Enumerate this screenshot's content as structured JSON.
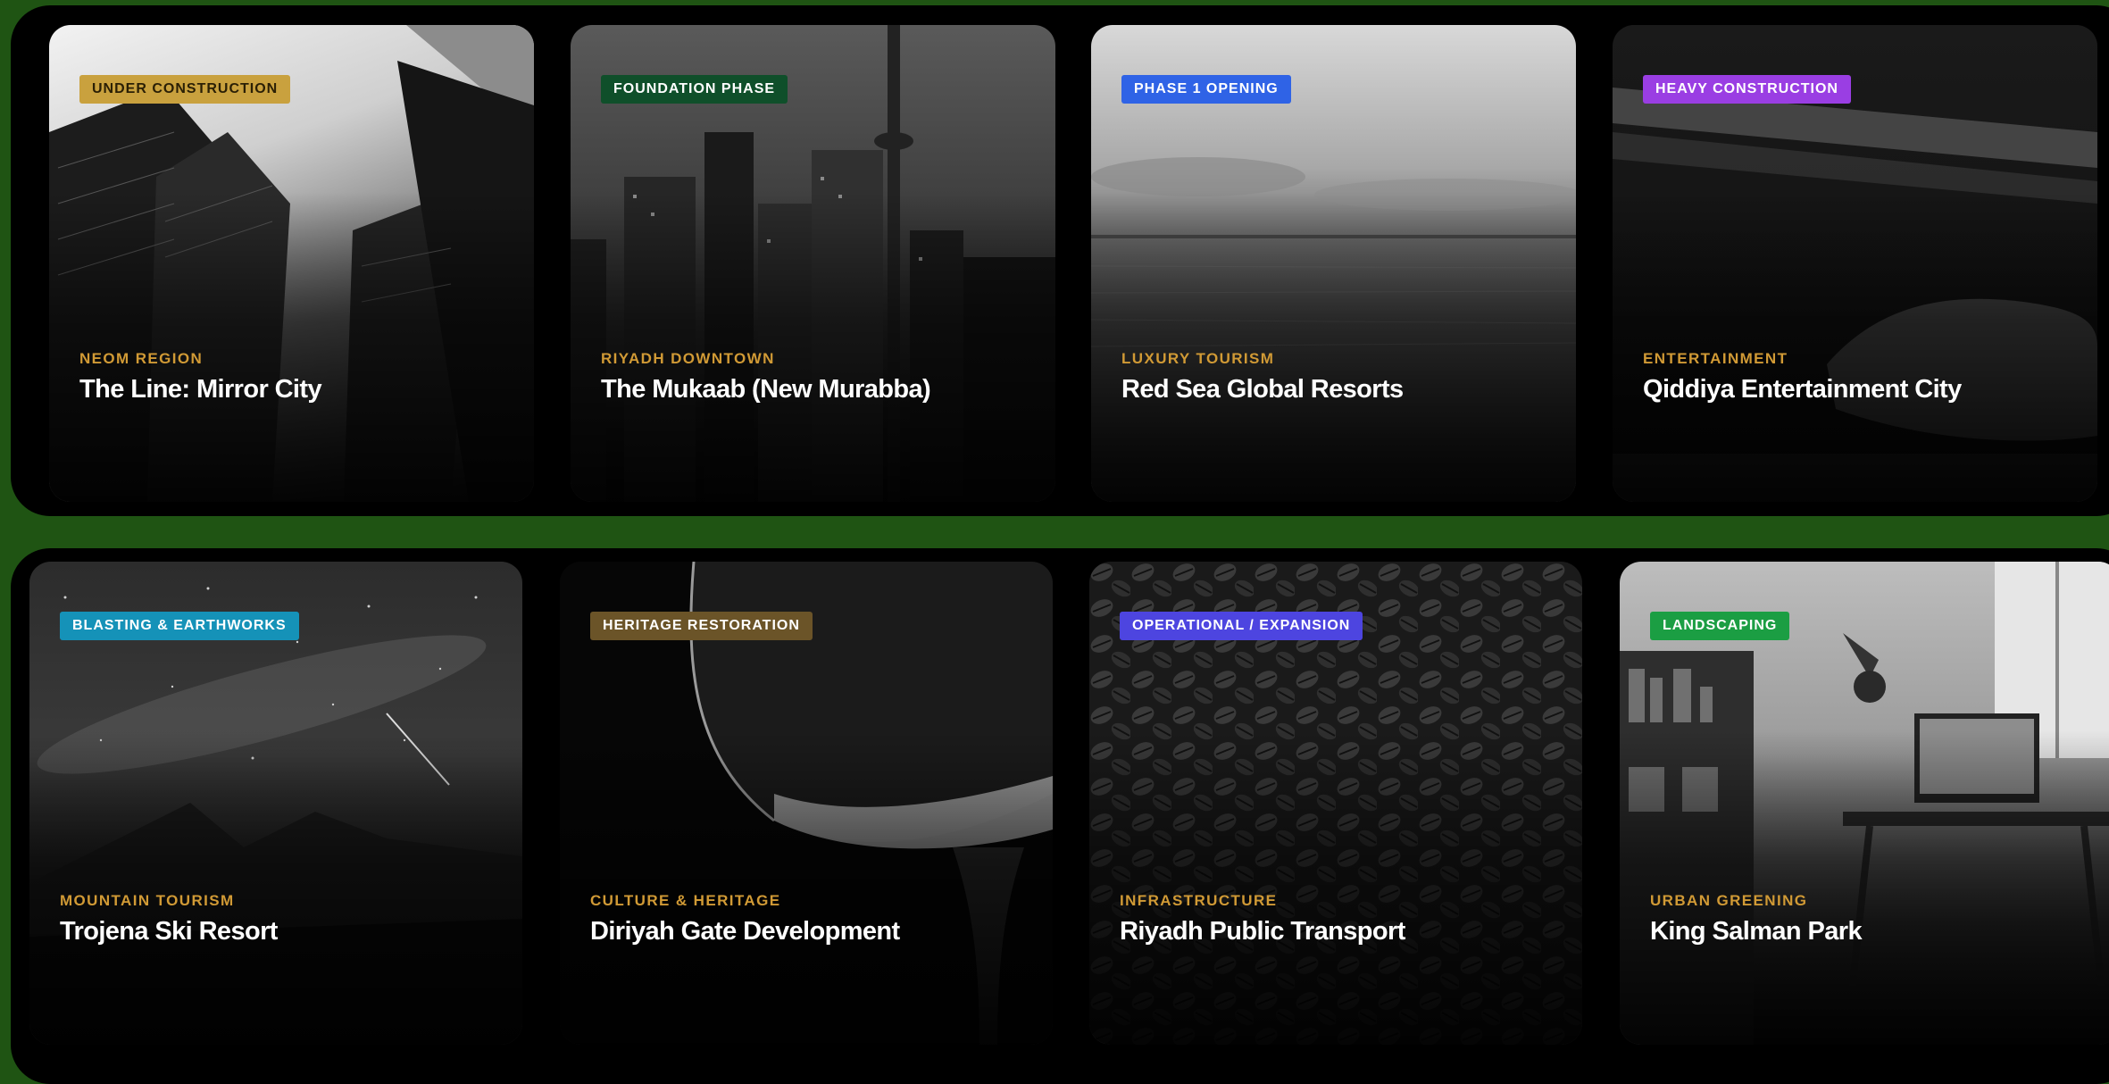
{
  "cards": [
    {
      "badge": "UNDER CONSTRUCTION",
      "badge_color": "#c9a13e",
      "category": "NEOM REGION",
      "title": "The Line: Mirror City"
    },
    {
      "badge": "FOUNDATION PHASE",
      "badge_color": "#0f4f2a",
      "category": "RIYADH DOWNTOWN",
      "title": "The Mukaab (New Murabba)"
    },
    {
      "badge": "PHASE 1 OPENING",
      "badge_color": "#2f63e6",
      "category": "LUXURY TOURISM",
      "title": "Red Sea Global Resorts"
    },
    {
      "badge": "HEAVY CONSTRUCTION",
      "badge_color": "#9a3ee3",
      "category": "ENTERTAINMENT",
      "title": "Qiddiya Entertainment City"
    },
    {
      "badge": "BLASTING & EARTHWORKS",
      "badge_color": "#1592b8",
      "category": "MOUNTAIN TOURISM",
      "title": "Trojena Ski Resort"
    },
    {
      "badge": "HERITAGE RESTORATION",
      "badge_color": "#6b5428",
      "category": "CULTURE & HERITAGE",
      "title": "Diriyah Gate Development"
    },
    {
      "badge": "OPERATIONAL / EXPANSION",
      "badge_color": "#4d45e0",
      "category": "INFRASTRUCTURE",
      "title": "Riyadh Public Transport"
    },
    {
      "badge": "LANDSCAPING",
      "badge_color": "#1b9e43",
      "category": "URBAN GREENING",
      "title": "King Salman Park"
    }
  ],
  "colors": {
    "page_background": "#1f5413",
    "panel_background": "#000000",
    "category_text": "#d19a35",
    "title_text": "#ffffff"
  }
}
